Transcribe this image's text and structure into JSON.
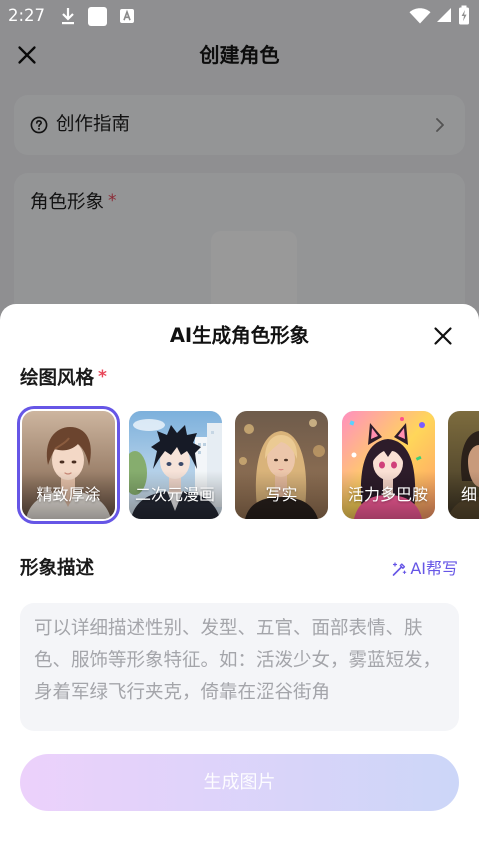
{
  "status_bar": {
    "time": "2:27",
    "icons": [
      "download-icon",
      "app-notification-icon",
      "a-notification-icon",
      "wifi-icon",
      "signal-icon",
      "battery-charging-icon"
    ]
  },
  "header": {
    "title": "创建角色",
    "close_icon": "close-icon"
  },
  "guide_card": {
    "icon": "question-circle-icon",
    "label": "创作指南",
    "trailing_icon": "chevron-right-icon"
  },
  "avatar_section": {
    "label": "角色形象",
    "required_mark": "*"
  },
  "sheet": {
    "title": "AI生成角色形象",
    "close_icon": "close-icon",
    "style_section": {
      "label": "绘图风格",
      "required_mark": "*"
    },
    "styles": [
      {
        "label": "精致厚涂",
        "selected": true
      },
      {
        "label": "二次元漫画",
        "selected": false
      },
      {
        "label": "写实",
        "selected": false
      },
      {
        "label": "活力多巴胺",
        "selected": false
      },
      {
        "label": "细",
        "selected": false
      }
    ],
    "description": {
      "label": "形象描述",
      "ai_help_icon": "magic-wand-icon",
      "ai_help_label": "AI帮写",
      "placeholder": "可以详细描述性别、发型、五官、面部表情、肤色、服饰等形象特征。如：活泼少女，雾蓝短发，身着军绿飞行夹克，倚靠在涩谷街角",
      "value": ""
    },
    "generate_button": {
      "label": "生成图片",
      "enabled": false
    }
  },
  "theme": {
    "accent": "#6656e6",
    "required": "#e8485a",
    "button_gradient_start": "#ecd1fb",
    "button_gradient_end": "#ccd6f8"
  }
}
